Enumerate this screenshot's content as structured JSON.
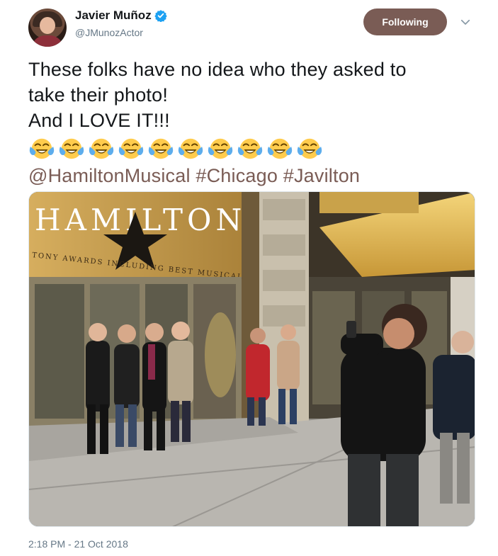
{
  "user": {
    "display_name": "Javier Muñoz",
    "handle": "@JMunozActor",
    "verified": true,
    "avatar_icon": "profile-photo"
  },
  "follow_button": {
    "label": "Following",
    "color": "#7a5c55"
  },
  "menu": {
    "icon": "chevron-down-icon"
  },
  "tweet": {
    "lines": [
      "These folks have no idea who they asked to",
      "take their photo!",
      "And I LOVE IT!!!"
    ],
    "emoji": {
      "name": "face-with-tears-of-joy",
      "count": 10
    },
    "tags": {
      "mention": "@HamiltonMusical",
      "hashtag1": "#Chicago",
      "hashtag2": "#Javilton"
    }
  },
  "photo": {
    "marquee_title": "HAMILTON",
    "marquee_subtitle": "TONY AWARDS INCLUDING BEST MUSICAL",
    "description_icon": "theater-photo"
  },
  "timestamp": "2:18 PM - 21 Oct 2018",
  "colors": {
    "link": "#7a5c55",
    "secondary_text": "#657786",
    "verified": "#1da1f2"
  }
}
